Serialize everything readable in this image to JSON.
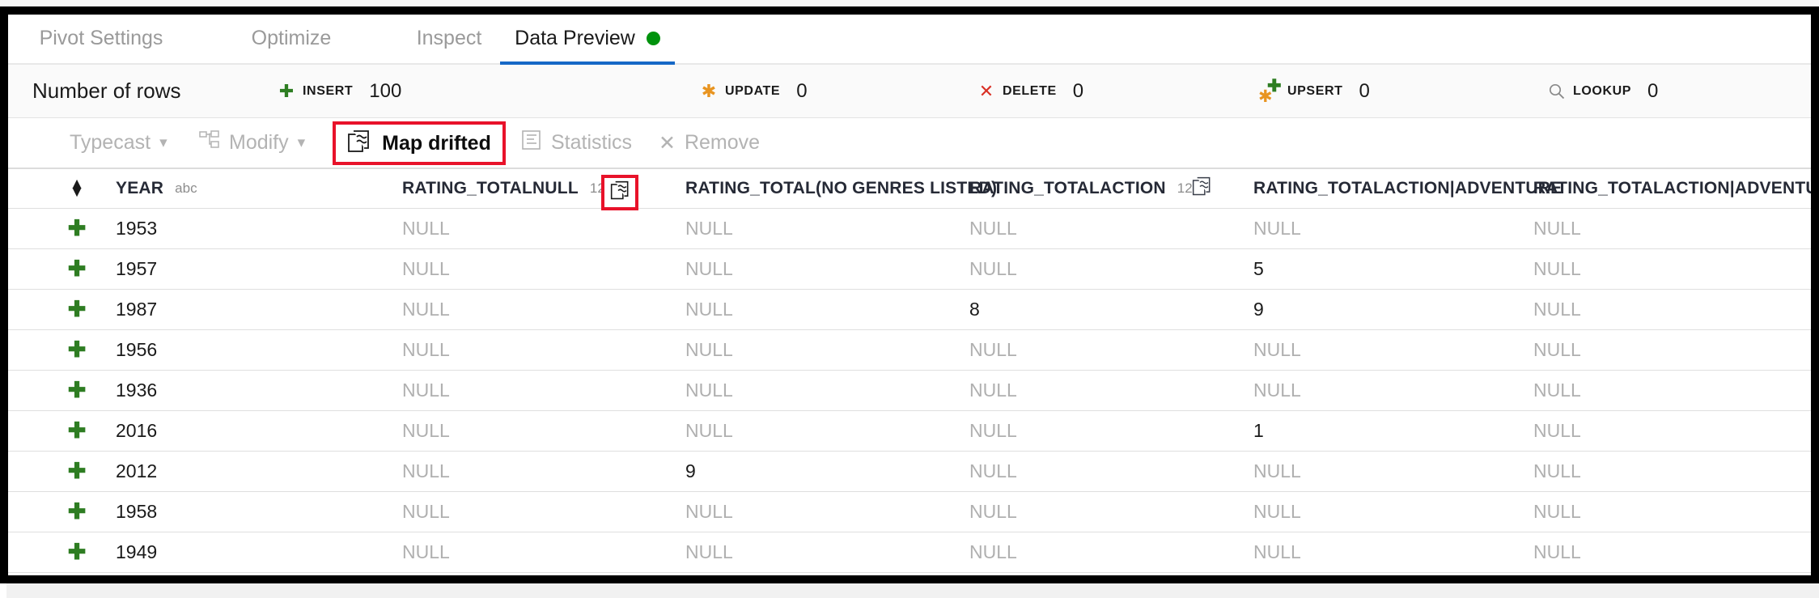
{
  "tabs": [
    {
      "label": "Pivot Settings",
      "active": false,
      "dot": false
    },
    {
      "label": "Optimize",
      "active": false,
      "dot": false
    },
    {
      "label": "Inspect",
      "active": false,
      "dot": false
    },
    {
      "label": "Data Preview",
      "active": true,
      "dot": true
    }
  ],
  "stats": {
    "title": "Number of rows",
    "items": [
      {
        "icon": "plus-icon",
        "label": "INSERT",
        "value": "100"
      },
      {
        "icon": "asterisk-icon",
        "label": "UPDATE",
        "value": "0"
      },
      {
        "icon": "cross-icon",
        "label": "DELETE",
        "value": "0"
      },
      {
        "icon": "asterisk-plus-icon",
        "label": "UPSERT",
        "value": "0"
      },
      {
        "icon": "search-icon",
        "label": "LOOKUP",
        "value": "0"
      }
    ]
  },
  "toolbar": {
    "typecast": "Typecast",
    "modify": "Modify",
    "map_drifted": "Map drifted",
    "statistics": "Statistics",
    "remove": "Remove"
  },
  "colors": {
    "accent_blue": "#1668c6",
    "status_green": "#00920d",
    "highlight_red": "#e8122a",
    "insert_green": "#2e7d22",
    "update_orange": "#e89420",
    "delete_red": "#d93025",
    "null_gray": "#b0b0b0"
  },
  "table": {
    "columns": [
      {
        "name": "YEAR",
        "type": "abc",
        "map_drifted": false,
        "highlighted": false
      },
      {
        "name": "RATING_TOTALNULL",
        "type": "12ǀ",
        "map_drifted": true,
        "highlighted": true
      },
      {
        "name": "RATING_TOTAL(NO GENRES LISTED)",
        "type": "",
        "map_drifted": false,
        "highlighted": false
      },
      {
        "name": "RATING_TOTALACTION",
        "type": "12ǀ",
        "map_drifted": true,
        "highlighted": false
      },
      {
        "name": "RATING_TOTALACTION|ADVENTURE",
        "type": "",
        "map_drifted": false,
        "highlighted": false
      },
      {
        "name": "RATING_TOTALACTION|ADVENTURE|A",
        "type": "",
        "map_drifted": false,
        "highlighted": false
      }
    ],
    "null_label": "NULL",
    "rows": [
      {
        "year": "1953",
        "cells": [
          "NULL",
          "NULL",
          "NULL",
          "NULL",
          "NULL"
        ]
      },
      {
        "year": "1957",
        "cells": [
          "NULL",
          "NULL",
          "NULL",
          "5",
          "NULL"
        ]
      },
      {
        "year": "1987",
        "cells": [
          "NULL",
          "NULL",
          "8",
          "9",
          "NULL"
        ]
      },
      {
        "year": "1956",
        "cells": [
          "NULL",
          "NULL",
          "NULL",
          "NULL",
          "NULL"
        ]
      },
      {
        "year": "1936",
        "cells": [
          "NULL",
          "NULL",
          "NULL",
          "NULL",
          "NULL"
        ]
      },
      {
        "year": "2016",
        "cells": [
          "NULL",
          "NULL",
          "NULL",
          "1",
          "NULL"
        ]
      },
      {
        "year": "2012",
        "cells": [
          "NULL",
          "9",
          "NULL",
          "NULL",
          "NULL"
        ]
      },
      {
        "year": "1958",
        "cells": [
          "NULL",
          "NULL",
          "NULL",
          "NULL",
          "NULL"
        ]
      },
      {
        "year": "1949",
        "cells": [
          "NULL",
          "NULL",
          "NULL",
          "NULL",
          "NULL"
        ]
      }
    ],
    "row_add_icon": "plus-icon",
    "sort_icon": "sort-updown-icon"
  }
}
